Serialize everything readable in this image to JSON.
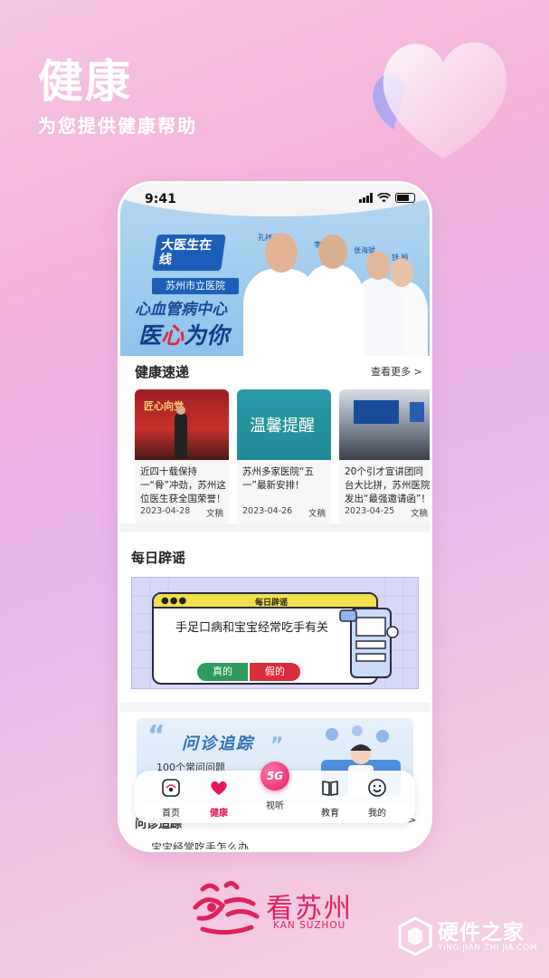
{
  "promo": {
    "title": "健康",
    "subtitle": "为您提供健康帮助"
  },
  "status_bar": {
    "time": "9:41"
  },
  "banner": {
    "badge": "大医生在线",
    "hospital": "苏州市立医院",
    "center": "心血管病中心",
    "slogan_a": "医",
    "slogan_b": "心",
    "slogan_c": "为你",
    "doctors": [
      "孔祥清",
      "李殿杰",
      "张海斌",
      "钱 颖"
    ]
  },
  "news": {
    "title": "健康速递",
    "more": "查看更多 >",
    "items": [
      {
        "title": "近四十载保持一“骨”冲劲，苏州这位医生获全国荣誉！",
        "date": "2023-04-28",
        "source": "文稿",
        "image_caption": "匠心向党"
      },
      {
        "title": "苏州多家医院“五一”最新安排！",
        "date": "2023-04-26",
        "source": "文稿",
        "image_caption": "温馨提醒"
      },
      {
        "title": "20个引才宣讲团同台大比拼，苏州医院发出“最强邀请函”！",
        "date": "2023-04-25",
        "source": "文稿",
        "image_caption": ""
      }
    ]
  },
  "rumor": {
    "title": "每日辟谣",
    "card_label": "每日辟谣",
    "dots": "●●●",
    "question": "手足口病和宝宝经常吃手有关",
    "true_label": "真的",
    "false_label": "假的"
  },
  "tracking": {
    "title": "问诊追踪",
    "subtitle": "100个常问问题",
    "behind_heading": "问诊追踪",
    "behind_more": ">",
    "behind_item": "宝宝经常吃手怎么办"
  },
  "tabbar": {
    "home": "首页",
    "health": "健康",
    "center": "5G",
    "video": "视听",
    "education": "教育",
    "mine": "我的"
  },
  "brand": {
    "name": "看苏州",
    "en": "KAN SUZHOU"
  },
  "watermark": {
    "name": "硬件之家",
    "url": "YING JIAN ZHI JIA.COM"
  }
}
